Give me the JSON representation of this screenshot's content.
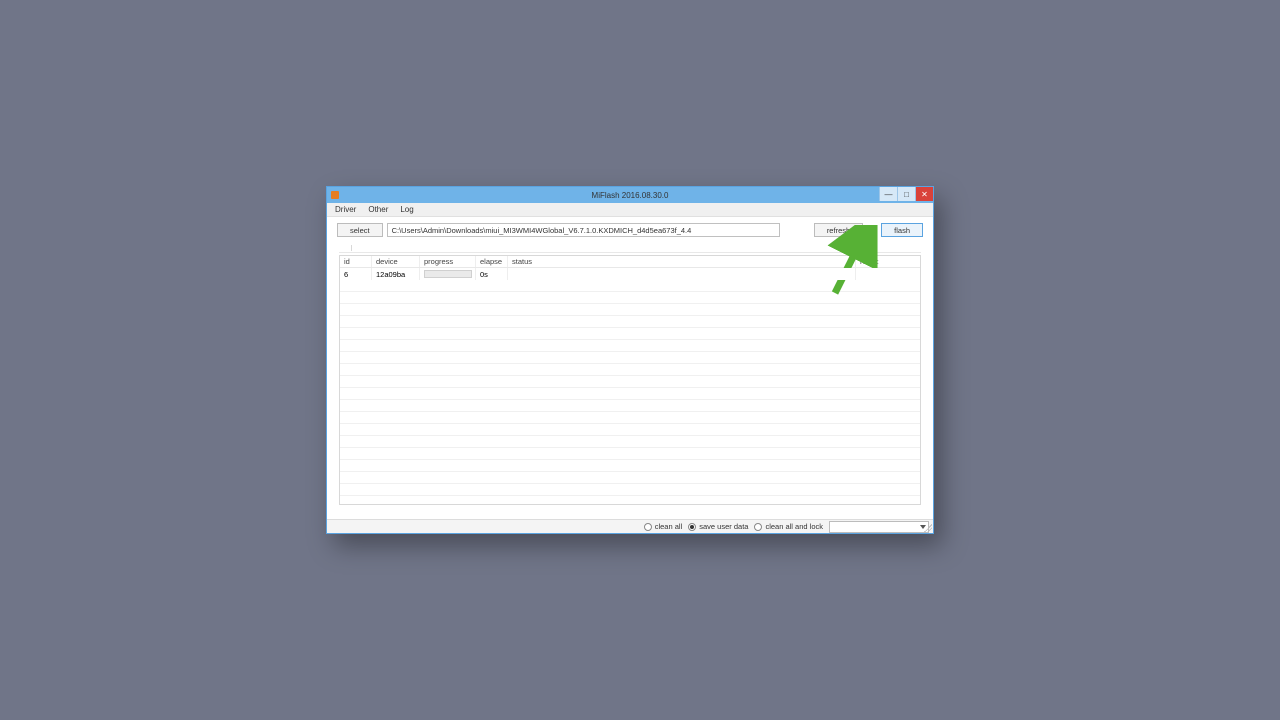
{
  "window": {
    "title": "MiFlash 2016.08.30.0"
  },
  "menu": {
    "driver": "Driver",
    "other": "Other",
    "log": "Log"
  },
  "toolbar": {
    "select_label": "select",
    "path_value": "C:\\Users\\Admin\\Downloads\\miui_MI3WMI4WGlobal_V6.7.1.0.KXDMICH_d4d5ea673f_4.4",
    "refresh_label": "refresh",
    "flash_label": "flash"
  },
  "table": {
    "headers": {
      "id": "id",
      "device": "device",
      "progress": "progress",
      "elapse": "elapse",
      "status": "status",
      "result": "result"
    },
    "rows": [
      {
        "id": "6",
        "device": "12a09ba",
        "elapse": "0s",
        "status": "",
        "result": ""
      }
    ]
  },
  "footer": {
    "clean_all": "clean all",
    "save_user_data": "save user data",
    "clean_all_and_lock": "clean all and lock",
    "selected": "save_user_data"
  },
  "annotation": {
    "arrow_color": "#57b135"
  }
}
